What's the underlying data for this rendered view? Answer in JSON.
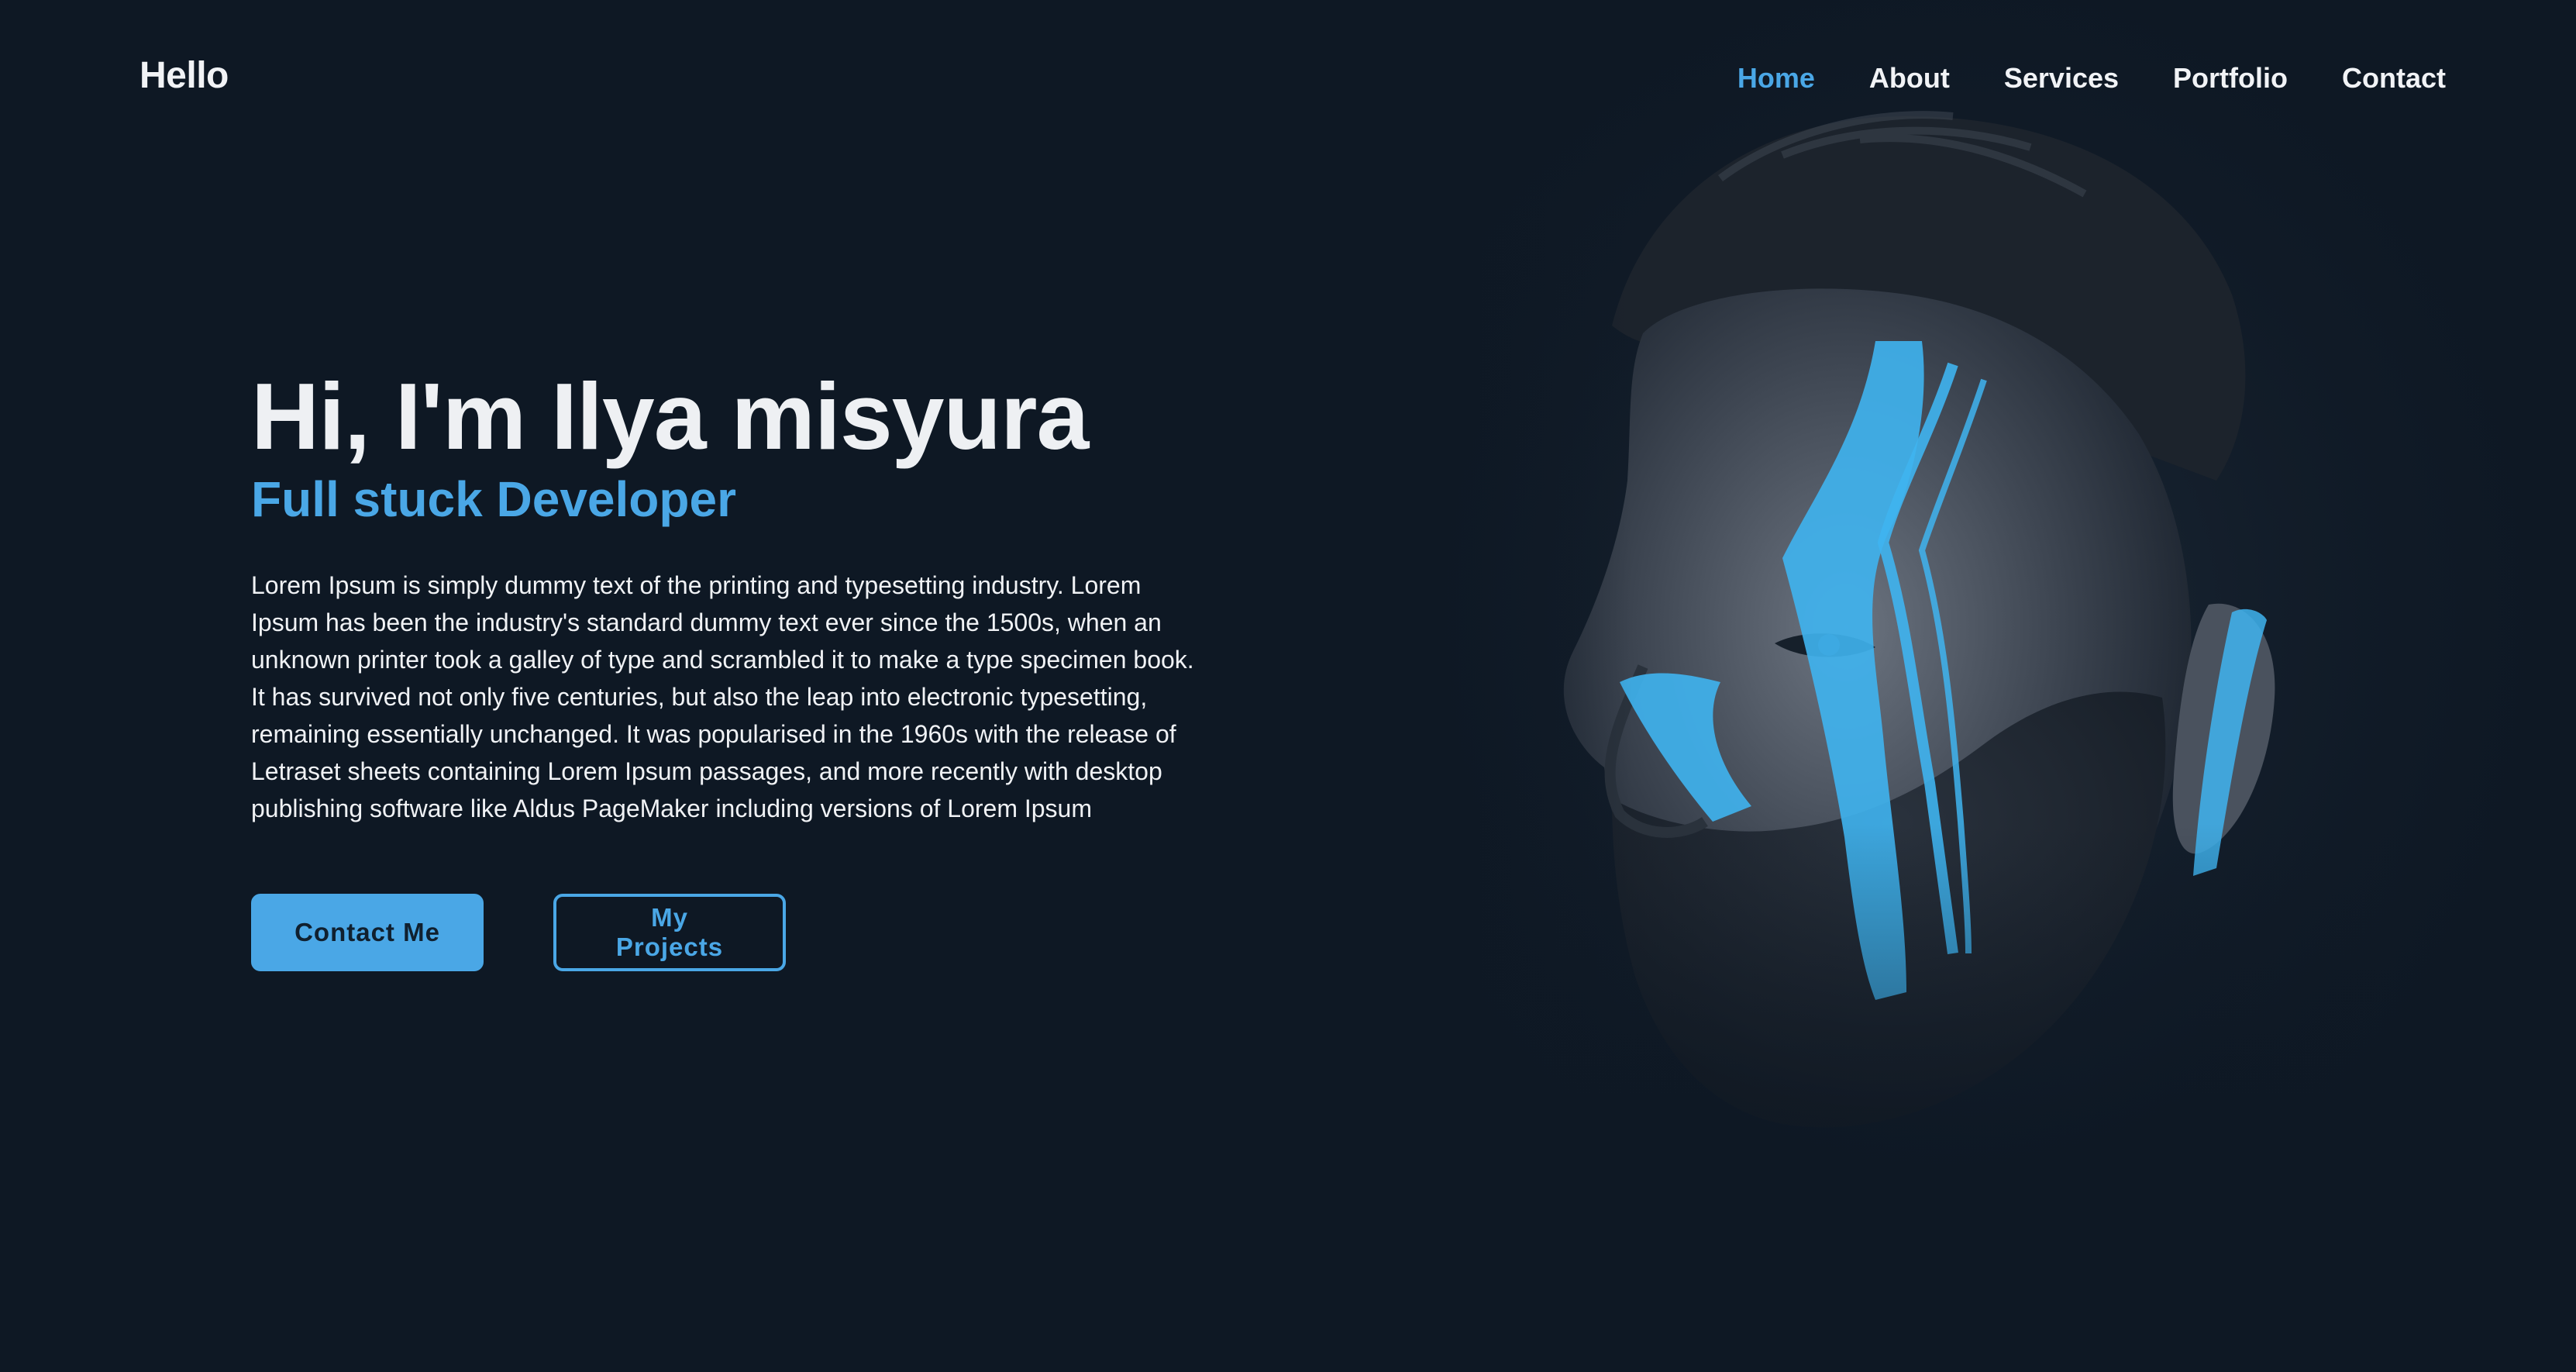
{
  "header": {
    "logo": "Hello",
    "nav": [
      {
        "label": "Home",
        "active": true
      },
      {
        "label": "About",
        "active": false
      },
      {
        "label": "Services",
        "active": false
      },
      {
        "label": "Portfolio",
        "active": false
      },
      {
        "label": "Contact",
        "active": false
      }
    ]
  },
  "hero": {
    "title": "Hi, I'm Ilya misyura",
    "subtitle": "Full stuck Developer",
    "description": "Lorem Ipsum is simply dummy text of the printing and typesetting industry. Lorem Ipsum has been the industry's standard dummy text ever since the 1500s, when an unknown printer took a galley of type and scrambled it to make a type specimen book. It has survived not only five centuries, but also the leap into electronic typesetting, remaining essentially unchanged. It was popularised in the 1960s with the release of Letraset sheets containing Lorem Ipsum passages, and more recently with desktop publishing software like Aldus PageMaker including versions of Lorem Ipsum",
    "primary_button": "Contact Me",
    "secondary_button": "My Projects"
  },
  "portrait": {
    "icon": "portrait-photo"
  },
  "colors": {
    "background": "#0e1824",
    "accent": "#4aa7e6",
    "text": "#f1f3f6"
  }
}
